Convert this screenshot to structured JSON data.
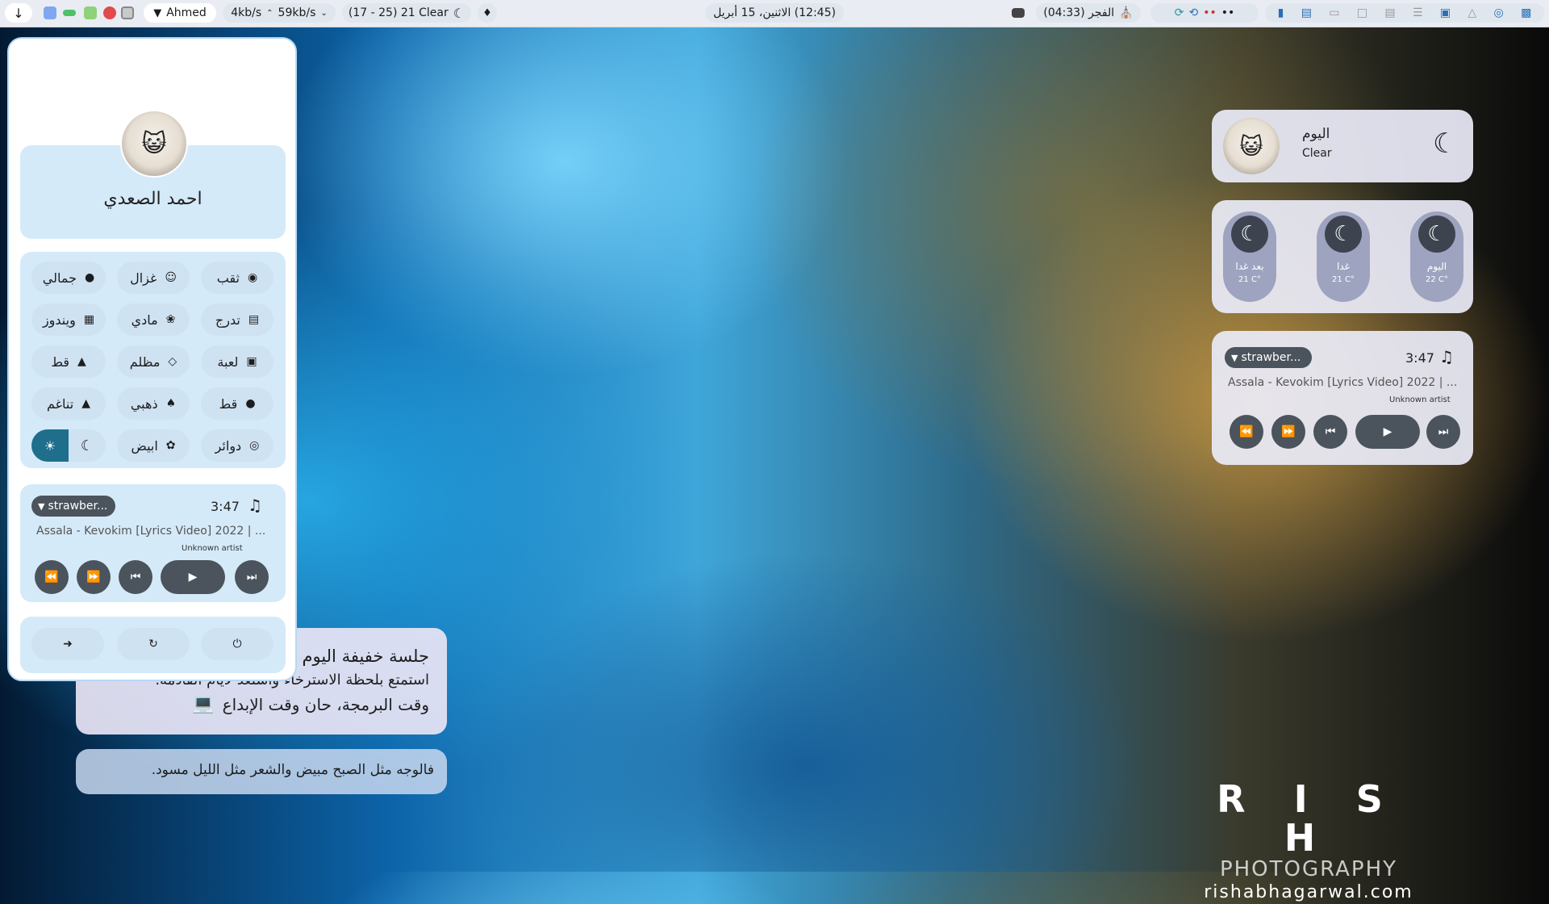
{
  "topbar": {
    "user": "Ahmed",
    "net_up": "4kb/s",
    "net_down": "59kb/s",
    "weather": "(17 - 25) 21 Clear",
    "datetime": "(12:45) الاثنين، 15 أبريل",
    "prayer": "(04:33) الفجر"
  },
  "profile": {
    "name": "احمد الصعدي"
  },
  "themes": {
    "rows": [
      [
        "ثقب",
        "غزال",
        "جمالي"
      ],
      [
        "تدرج",
        "مادي",
        "ويندوز"
      ],
      [
        "لعبة",
        "مظلم",
        "قط"
      ],
      [
        "قط",
        "ذهبي",
        "تناغم"
      ],
      [
        "دوائر",
        "ابيض"
      ]
    ]
  },
  "player": {
    "source": "strawber...",
    "time": "3:47",
    "title": "Assala - Kevokim [Lyrics Video] 2022",
    "title_extra": "| ...",
    "artist": "Unknown artist"
  },
  "weather_card": {
    "title": "اليوم",
    "condition": "Clear"
  },
  "forecast": [
    {
      "label": "بعد غدا",
      "temp": "21 C°"
    },
    {
      "label": "غدا",
      "temp": "21 C°"
    },
    {
      "label": "اليوم",
      "temp": "22 C°"
    }
  ],
  "notes": {
    "line1": "جلسة خفيفة اليوم",
    "line2": "استمتع بلحظة الاسترخاء واستعد لأيام القادمة.",
    "line3": "وقت البرمجة، حان وقت الإبداع",
    "quote": "فالوجه مثل الصبح مبيض والشعر مثل الليل مسود."
  },
  "watermark": {
    "brand": "R I S H",
    "sub": "PHOTOGRAPHY",
    "url": "rishabhagarwal.com"
  },
  "icons": {
    "down": "arrow-down-icon",
    "wifi": "wifi-icon",
    "moon": "moon-icon",
    "bell": "bell-icon",
    "mosque": "mosque-icon",
    "music": "music-note-icon"
  }
}
